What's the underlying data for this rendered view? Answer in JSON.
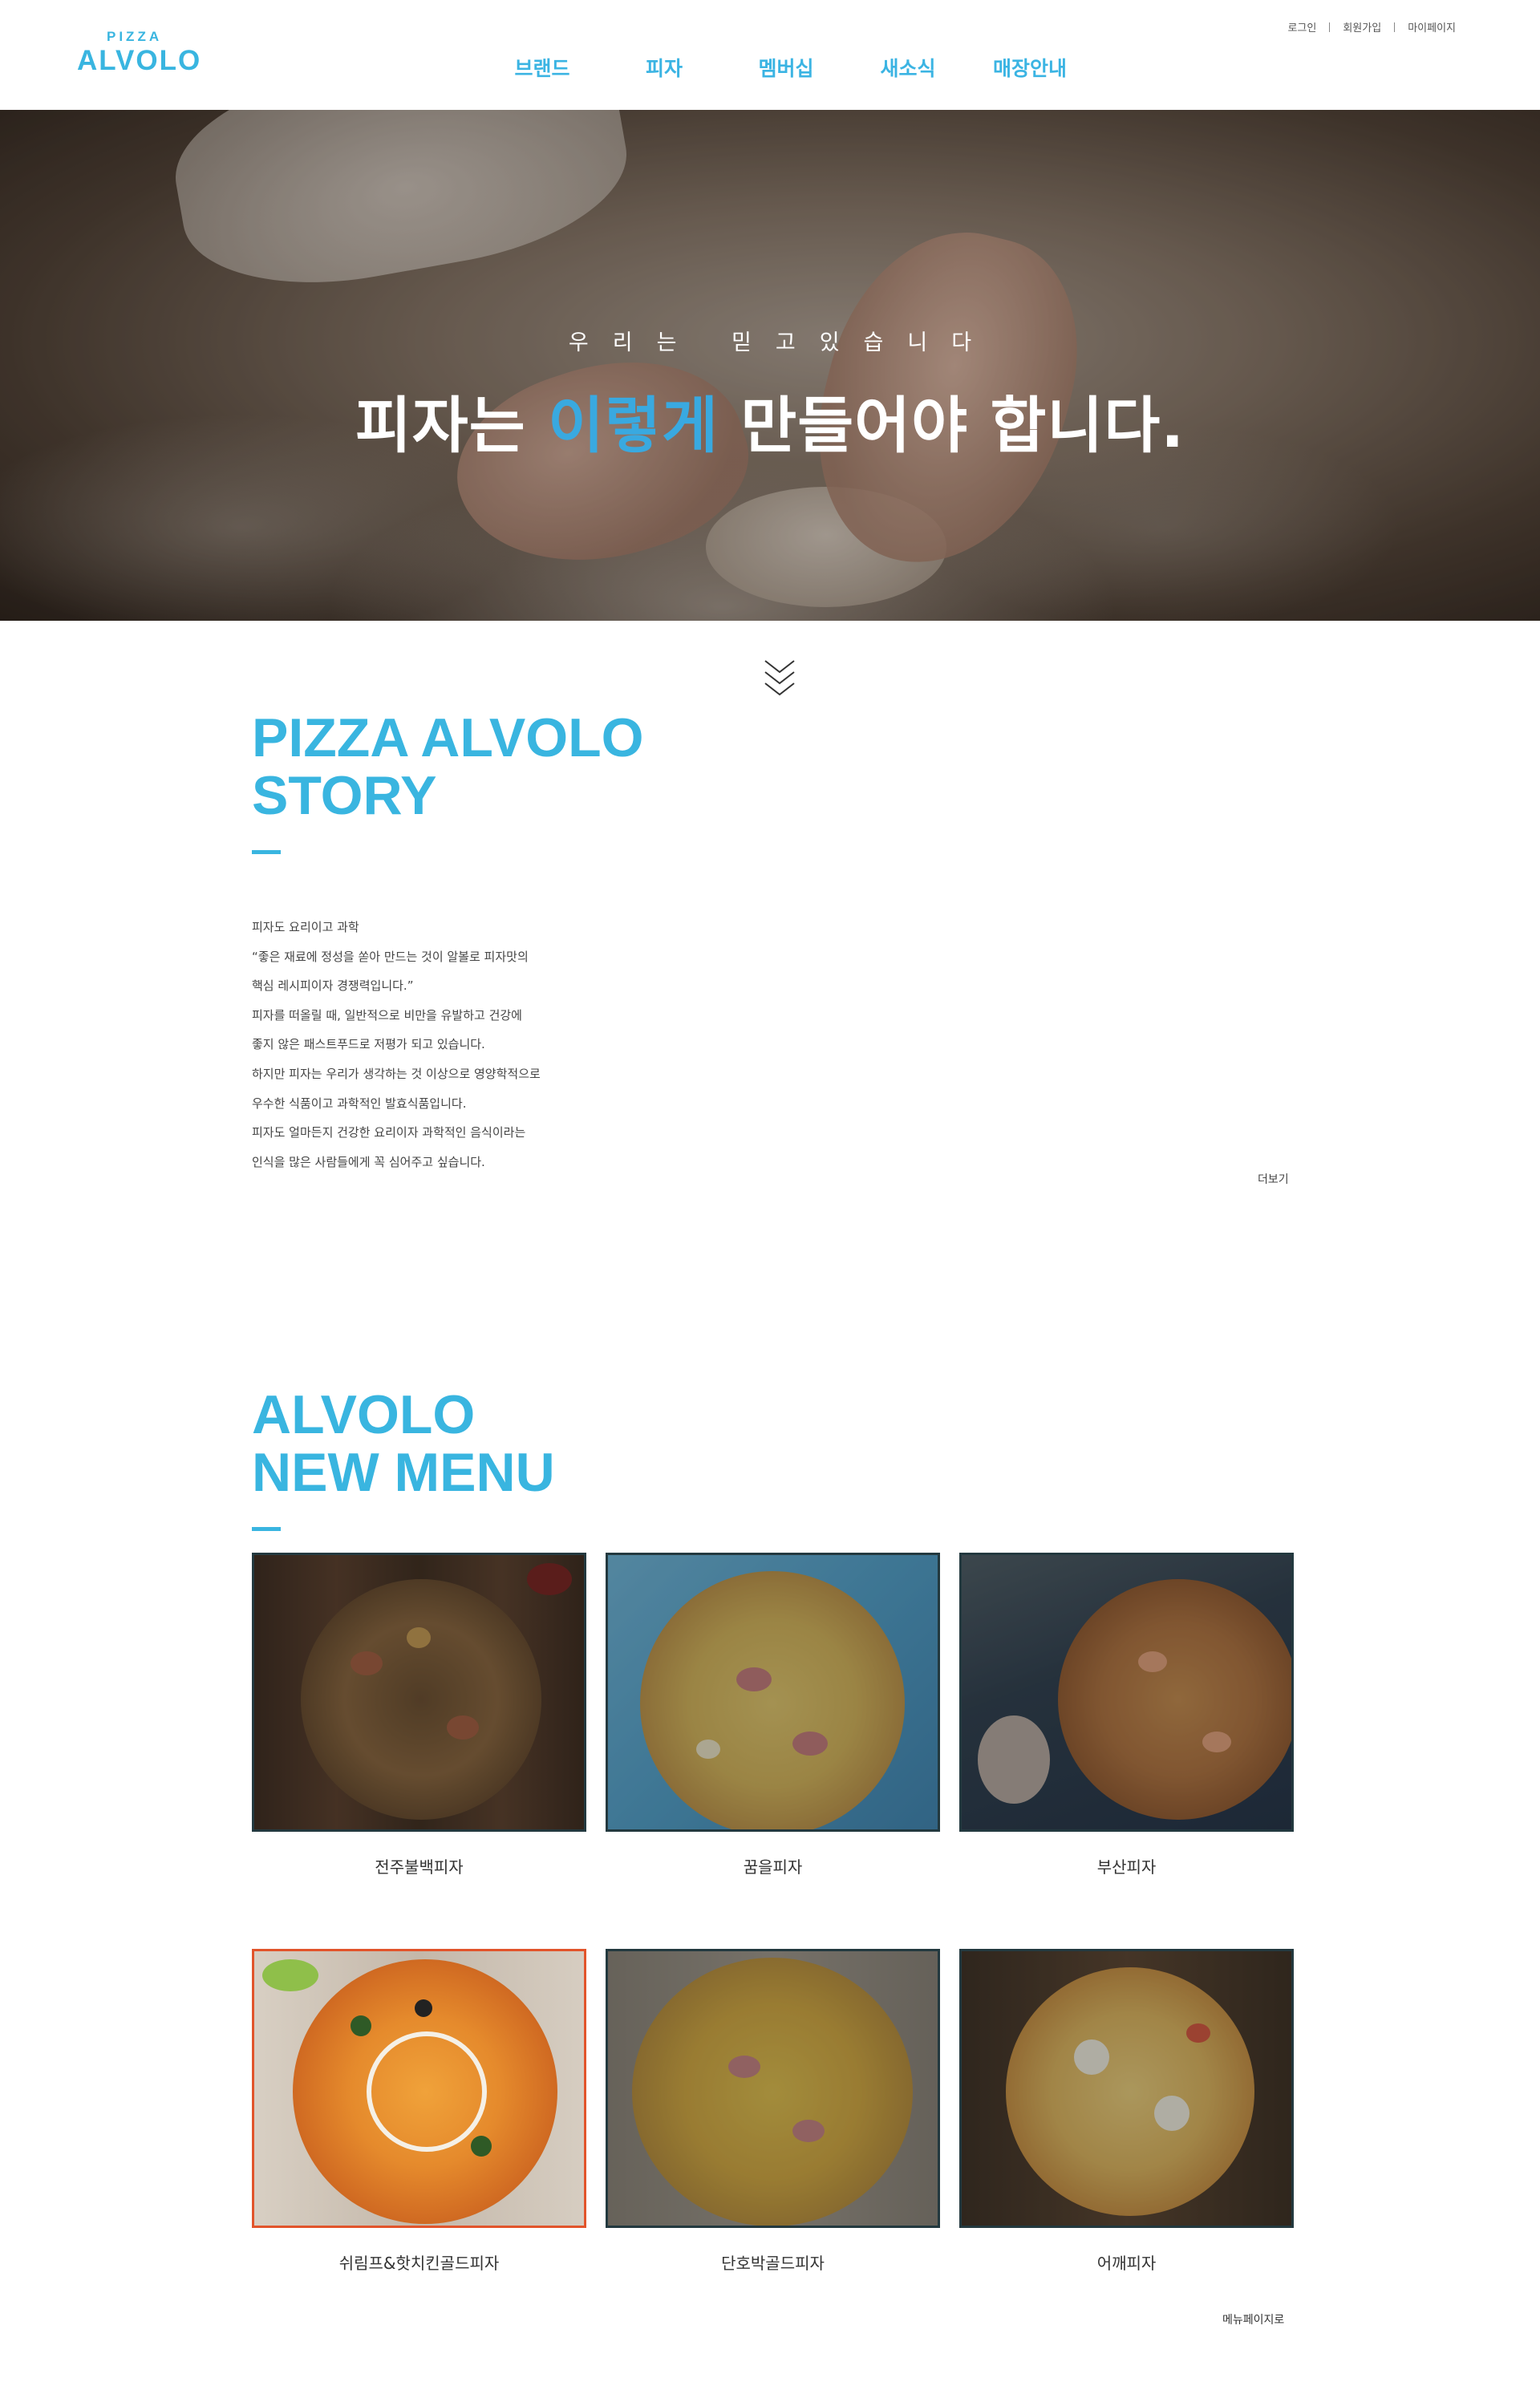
{
  "brand": {
    "logo_top": "PIZZA",
    "logo_main": "ALVOLO",
    "accent_color": "#39b5e0",
    "highlight_color": "#e2542b"
  },
  "nav": {
    "items": [
      {
        "label": "브랜드"
      },
      {
        "label": "피자"
      },
      {
        "label": "멤버십"
      },
      {
        "label": "새소식"
      },
      {
        "label": "매장안내"
      }
    ]
  },
  "util": {
    "login": "로그인",
    "signup": "회원가입",
    "mypage": "마이페이지"
  },
  "hero": {
    "subtitle": "우리는 믿고있습니다",
    "title_before": "피자는 ",
    "title_highlight": "이렇게",
    "title_after": " 만들어야 합니다."
  },
  "story": {
    "title_line1": "PIZZA ALVOLO",
    "title_line2": "STORY",
    "lines": [
      "피자도 요리이고 과학",
      "“좋은 재료에 정성을 쏟아 만드는 것이 알볼로 피자맛의",
      "핵심 레시피이자 경쟁력입니다.”",
      "피자를 떠올릴 때, 일반적으로 비만을 유발하고 건강에",
      "좋지 않은 패스트푸드로 저평가 되고 있습니다.",
      "하지만 피자는 우리가 생각하는 것 이상으로 영양학적으로",
      "우수한 식품이고 과학적인 발효식품입니다.",
      "피자도 얼마든지 건강한 요리이자 과학적인 음식이라는",
      "인식을 많은 사람들에게 꼭 심어주고 싶습니다."
    ],
    "more_label": "더보기"
  },
  "new_menu": {
    "title_line1": "ALVOLO",
    "title_line2": "NEW MENU",
    "items": [
      {
        "name": "전주불백피자",
        "theme": "dark-wood",
        "selected": false
      },
      {
        "name": "꿈을피자",
        "theme": "blue-board",
        "selected": false
      },
      {
        "name": "부산피자",
        "theme": "seafood",
        "selected": false
      },
      {
        "name": "쉬림프&핫치킨골드피자",
        "theme": "light-wood",
        "selected": true
      },
      {
        "name": "단호박골드피자",
        "theme": "pumpkin",
        "selected": false
      },
      {
        "name": "어깨피자",
        "theme": "cheese",
        "selected": false
      }
    ],
    "menu_page_label": "메뉴페이지로"
  },
  "icons": {
    "scroll": "triple-chevron-down-icon"
  }
}
